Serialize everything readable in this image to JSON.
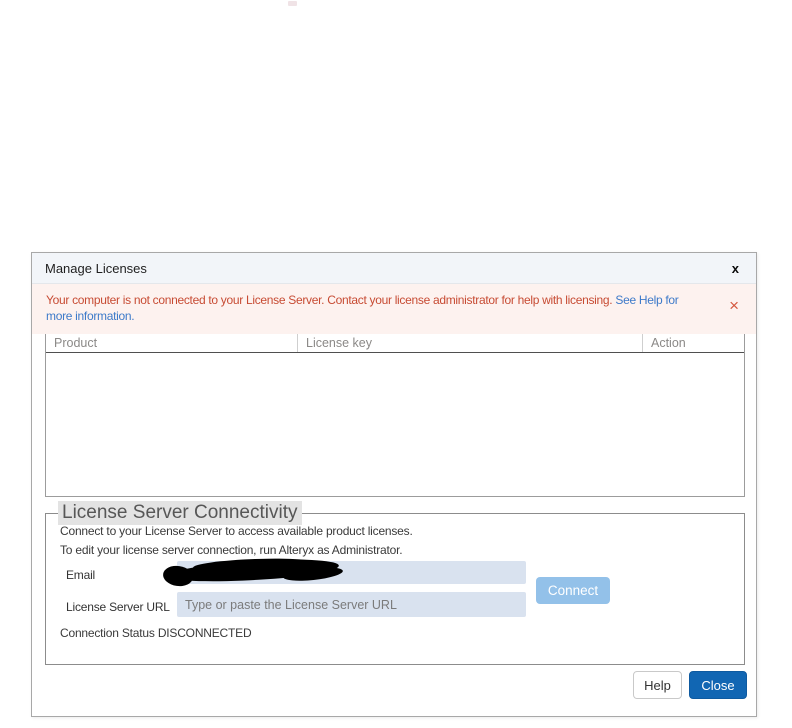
{
  "dialog": {
    "title": "Manage Licenses",
    "close_glyph": "x"
  },
  "banner": {
    "message": "Your computer is not connected to your License Server. Contact your license administrator for help with licensing.",
    "link_text": "See Help for more information.",
    "dismiss_glyph": "×",
    "background": "#fdf2ef",
    "text_color": "#c74b33",
    "link_color": "#3d7ac9"
  },
  "table": {
    "columns": [
      "Product",
      "License key",
      "Action"
    ],
    "rows": []
  },
  "connectivity": {
    "legend": "License Server Connectivity",
    "line1": "Connect to your License Server to access available product licenses.",
    "line2": "To edit your license server connection, run Alteryx as Administrator.",
    "email_label": "Email",
    "email_value": "",
    "url_label": "License Server URL",
    "url_placeholder": "Type or paste the License Server URL",
    "url_value": "",
    "connect_label": "Connect",
    "status_label": "Connection Status",
    "status_value": "DISCONNECTED"
  },
  "footer": {
    "help_label": "Help",
    "close_label": "Close"
  },
  "colors": {
    "connect_button": "#93c1e9",
    "close_button": "#1166b3",
    "input_background": "#d9e2ef",
    "titlebar_background": "#f2f5f9"
  }
}
